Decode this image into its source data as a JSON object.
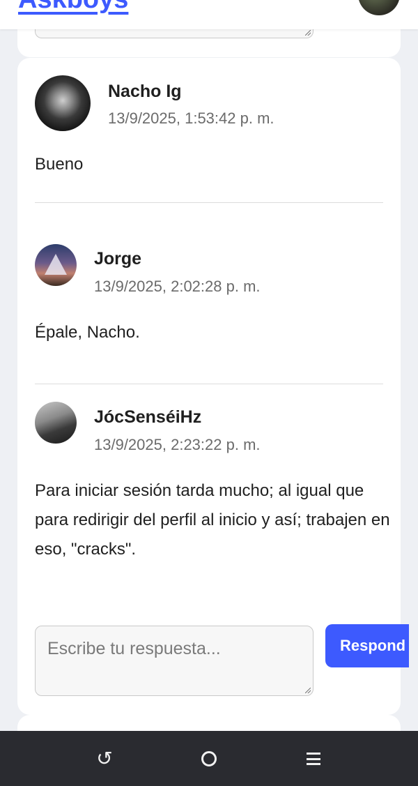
{
  "header": {
    "brand": "Askboys",
    "avatar_icon": "user-avatar-icon"
  },
  "post": {
    "author": "Nacho Ig",
    "timestamp": "13/9/2025, 1:53:42 p. m.",
    "text": "Bueno"
  },
  "replies": [
    {
      "author": "Jorge",
      "timestamp": "13/9/2025, 2:02:28 p. m.",
      "text": "Épale, Nacho."
    },
    {
      "author": "JócSenséiHz",
      "timestamp": "13/9/2025, 2:23:22 p. m.",
      "text": "Para iniciar sesión tarda mucho; al igual que para redirigir del perfil al inicio y así; trabajen en eso, \"cracks\"."
    }
  ],
  "reply_form": {
    "placeholder": "Escribe tu respuesta...",
    "button_label": "Respond"
  },
  "navbar": {
    "back_icon": "back-icon",
    "home_icon": "home-icon",
    "recent_icon": "recent-apps-icon"
  },
  "colors": {
    "accent": "#3d5afe",
    "navbar": "#2a2b30",
    "background": "#eef0f4"
  }
}
